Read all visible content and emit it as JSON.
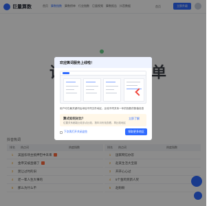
{
  "app": {
    "logo_text": "巨量算数",
    "nav": [
      "首页",
      "算数指数",
      "算数榜单",
      "行业指数",
      "巨量视频",
      "算数报告",
      "抖音数据"
    ],
    "active_nav": 1,
    "home_link": "首页",
    "upgrade_label": "立即升级"
  },
  "hero": {
    "title_left": "请",
    "title_right": "单"
  },
  "background_table": {
    "section_label": "抖音热词",
    "left": {
      "headers": [
        "排名",
        "热点词",
        "热度指数"
      ],
      "rows": [
        {
          "rank": "1",
          "keyword": "美国农场主抵押巴中未来",
          "value": "",
          "hot": true
        },
        {
          "rank": "2",
          "keyword": "金帝又被直播了",
          "value": "",
          "hot": true
        },
        {
          "rank": "3",
          "keyword": "莫让过时的旧",
          "value": "",
          "hot": false
        },
        {
          "rank": "4",
          "keyword": "老一辈人生大事的",
          "value": "",
          "hot": false
        },
        {
          "rank": "5",
          "keyword": "那么为什么不",
          "value": "",
          "hot": false
        }
      ]
    },
    "right": {
      "headers": [
        "排名",
        "热点词",
        "热度指数"
      ],
      "rows": [
        {
          "rank": "1",
          "keyword": "国家网信办答",
          "value": "",
          "hot": false
        },
        {
          "rank": "2",
          "keyword": "赵某生活大宝丽",
          "value": "",
          "hot": false
        },
        {
          "rank": "3",
          "keyword": "开开心心过",
          "value": "",
          "hot": false
        },
        {
          "rank": "4",
          "keyword": "5个金鸡奖新人奖",
          "value": "",
          "hot": false
        },
        {
          "rank": "5",
          "keyword": "赵盼盼",
          "value": "",
          "hot": false
        }
      ]
    }
  },
  "modal": {
    "title": "欢迎算词服务上线啦！",
    "description": "用户可在最关键词后添加不同文件地区，比较不同关系一年的指数的数值信息",
    "tip_title": "算式如何对比？",
    "tip_link": "立即了解",
    "tip_text": "位置关系都能比较多点比较，按年月份找查看，再比较地区",
    "checkbox_label": "下次再打开关闭这些",
    "confirm_label": "领取更多地区"
  },
  "colors": {
    "accent": "#2f6bff",
    "overlay": "rgba(0,0,0,0.45)",
    "tip_bg": "#fff7e8",
    "arrow": "#f0483e"
  },
  "icons": {
    "logo": "brand-logo-icon",
    "avatar": "user-avatar-icon",
    "float": "assistant-float-icon"
  }
}
